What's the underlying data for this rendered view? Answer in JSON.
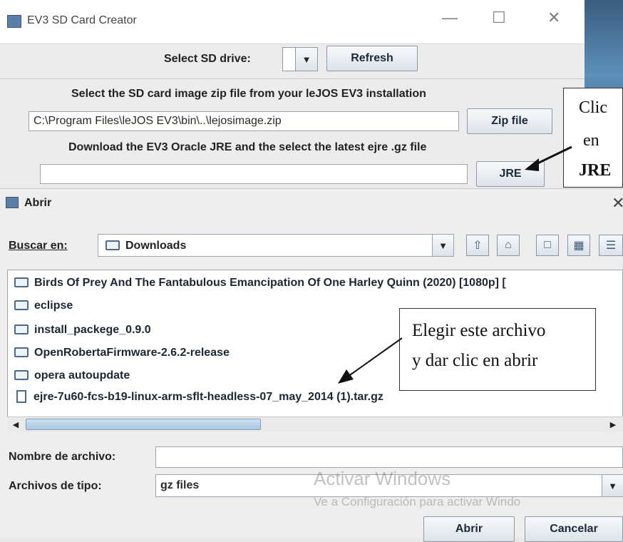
{
  "creator": {
    "title": "EV3 SD Card Creator",
    "select_drive_label": "Select SD drive:",
    "refresh_label": "Refresh",
    "zip_instruction": "Select the SD card image zip file from your leJOS EV3 installation",
    "zip_path": "C:\\Program Files\\leJOS EV3\\bin\\..\\lejosimage.zip",
    "zip_button": "Zip file",
    "jre_instruction": "Download the EV3 Oracle JRE and the select the latest ejre .gz file",
    "jre_path": "",
    "jre_button": "JRE"
  },
  "callout1": {
    "lines": [
      "Clic",
      "en",
      "JRE"
    ]
  },
  "dialog": {
    "title": "Abrir",
    "look_in_label": "Buscar en:",
    "look_in_value": "Downloads",
    "files": [
      {
        "name": "Birds Of Prey And The Fantabulous Emancipation Of One Harley Quinn (2020) [1080p] [",
        "type": "folder"
      },
      {
        "name": "eclipse",
        "type": "folder"
      },
      {
        "name": "install_packege_0.9.0",
        "type": "folder"
      },
      {
        "name": "OpenRobertaFirmware-2.6.2-release",
        "type": "folder"
      },
      {
        "name": "opera autoupdate",
        "type": "folder"
      },
      {
        "name": "ejre-7u60-fcs-b19-linux-arm-sflt-headless-07_may_2014 (1).tar.gz",
        "type": "file"
      }
    ],
    "filename_label": "Nombre de archivo:",
    "filename_value": "",
    "filetype_label": "Archivos de tipo:",
    "filetype_value": "gz files",
    "open_button": "Abrir",
    "cancel_button": "Cancelar"
  },
  "callout2": {
    "lines": [
      "Elegir este archivo",
      "y dar clic en abrir"
    ]
  },
  "watermark": {
    "line1": "Activar Windows",
    "line2": "Ve a Configuración para activar Windo"
  }
}
